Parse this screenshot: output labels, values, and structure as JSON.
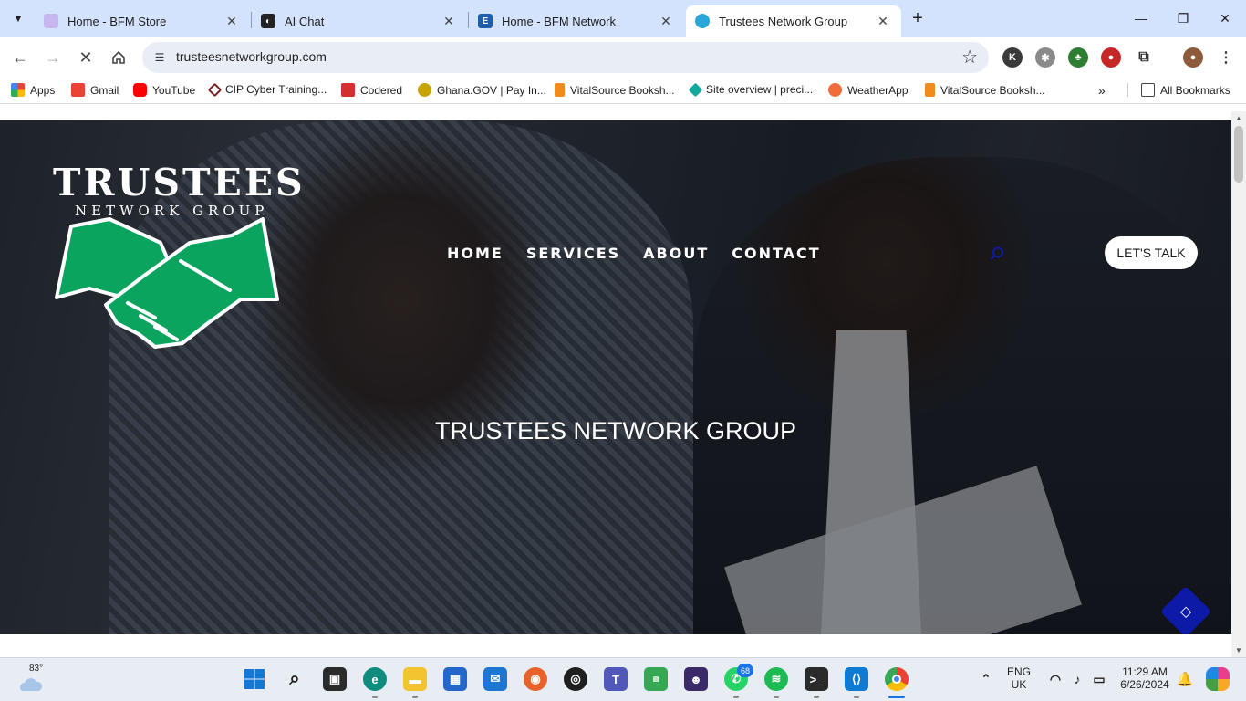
{
  "tabs": [
    {
      "title": "Home - BFM Store",
      "close": "✕"
    },
    {
      "title": "AI Chat",
      "close": "✕"
    },
    {
      "title": "Home - BFM Network",
      "close": "✕"
    },
    {
      "title": "Trustees Network Group",
      "close": "✕"
    }
  ],
  "omnibox": {
    "url": "trusteesnetworkgroup.com"
  },
  "bookmarks": {
    "items": [
      "Apps",
      "Gmail",
      "YouTube",
      "CIP Cyber Training...",
      "Codered",
      "Ghana.GOV | Pay In...",
      "VitalSource Booksh...",
      "Site overview | preci...",
      "WeatherApp",
      "VitalSource Booksh..."
    ],
    "all_bookmarks": "All Bookmarks"
  },
  "site": {
    "logo_main": "TRUSTEES",
    "logo_sub": "NETWORK GROUP",
    "nav": [
      "HOME",
      "SERVICES",
      "ABOUT",
      "CONTACT"
    ],
    "cta": "LET'S TALK",
    "hero_title": "TRUSTEES NETWORK GROUP",
    "accent_color": "#0d1aa8",
    "logo_green": "#0aa45f"
  },
  "taskbar": {
    "weather_temp": "83°",
    "whatsapp_badge": "68",
    "language_top": "ENG",
    "language_bottom": "UK",
    "time": "11:29 AM",
    "date": "6/26/2024"
  }
}
